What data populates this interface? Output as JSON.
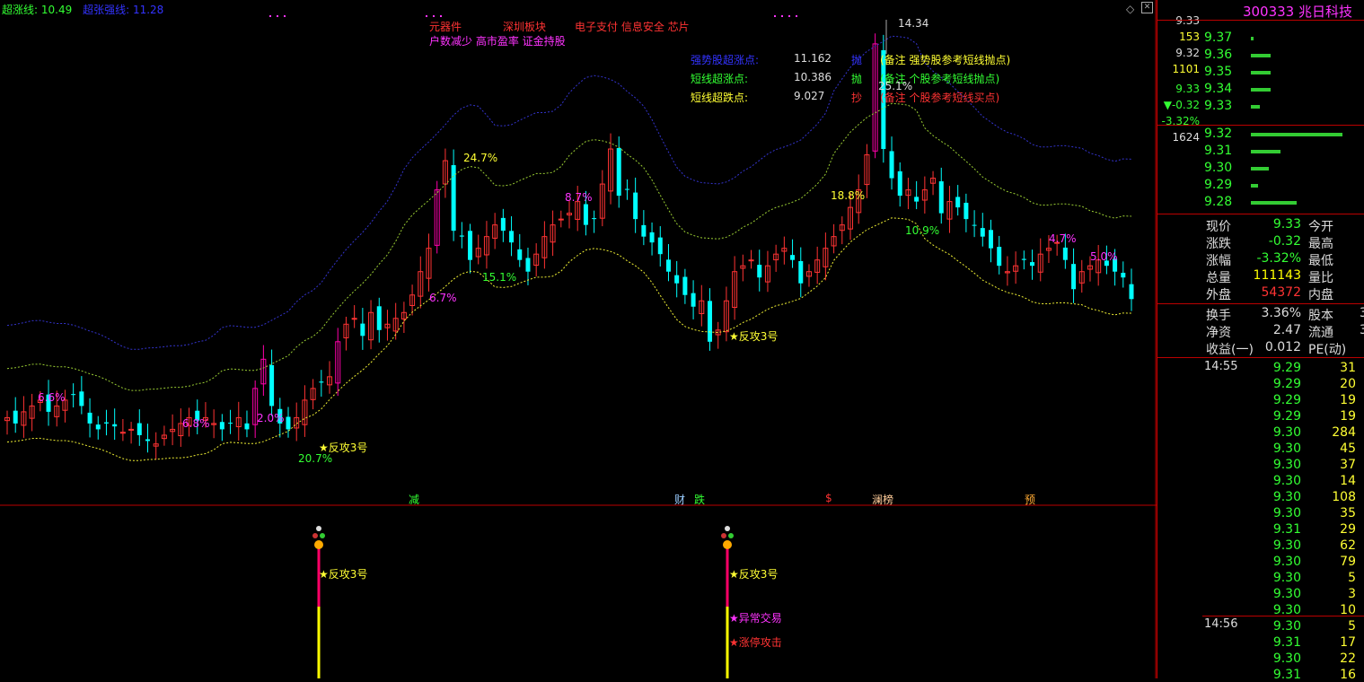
{
  "header": {
    "legend_label_1": "超涨线:",
    "legend_value_1": "10.49",
    "legend_label_2": "超张强线:",
    "legend_value_2": "11.28"
  },
  "concepts": {
    "line1": [
      "元器件",
      "深圳板块",
      "电子支付 信息安全 芯片"
    ],
    "line2": "户数减少 高市盈率 证金持股"
  },
  "info_box": {
    "rows": [
      {
        "label": "强势股超涨点:",
        "value": "11.162",
        "action": "抛",
        "note": "(备注 强势股参考短线抛点)",
        "color": "#33f"
      },
      {
        "label": "短线超涨点:",
        "value": "10.386",
        "action": "抛",
        "note": "(备注 个股参考短线抛点)",
        "color": "#3f3"
      },
      {
        "label": "短线超跌点:",
        "value": "9.027",
        "action": "抄",
        "note": "(备注 个股参考短线买点)",
        "color": "#ff3"
      }
    ]
  },
  "chart_labels": {
    "high_label": "14.34",
    "percentages": [
      "6.6%",
      "6.8%",
      "2.0%",
      "20.7%",
      "6.7%",
      "24.7%",
      "15.1%",
      "8.7%",
      "18.8%",
      "25.1%",
      "10.9%",
      "4.7%",
      "5.0%"
    ],
    "signal_main": "★反攻3号",
    "signal_main_2": "★反攻3号",
    "bottom_markers": [
      "减",
      "财",
      "跌",
      "$",
      "澜榜",
      "预"
    ],
    "sub_signal_1": "★反攻3号",
    "sub_signal_2": "★反攻3号",
    "sub_signal_3": "★异常交易",
    "sub_signal_4": "★涨停攻击"
  },
  "chart_data": {
    "type": "candlestick",
    "y_axis_main": [
      "12.00",
      "11.50",
      "11.00",
      "10.50",
      "10.00",
      "9.50",
      "9.00",
      "8.50",
      "8.00",
      "7.50",
      "7.00",
      "6.50"
    ],
    "y_axis_sub": [
      "10.00",
      "8.00",
      "6.00",
      "4.00",
      "2.00"
    ],
    "ylim_main": [
      6.2,
      12.3
    ],
    "closes": [
      7.3,
      7.2,
      7.4,
      7.5,
      7.6,
      7.4,
      7.5,
      7.6,
      7.7,
      7.5,
      7.2,
      7.1,
      7.2,
      7.15,
      7.05,
      7.1,
      7.0,
      6.9,
      6.85,
      7.0,
      7.1,
      7.2,
      7.3,
      7.25,
      7.3,
      7.2,
      7.1,
      7.2,
      7.3,
      7.1,
      7.8,
      8.3,
      7.5,
      7.2,
      7.1,
      7.3,
      7.6,
      7.8,
      7.9,
      8.0,
      8.6,
      8.9,
      9.0,
      8.7,
      9.1,
      8.8,
      8.9,
      9.0,
      9.1,
      9.4,
      9.8,
      10.2,
      11.2,
      11.7,
      10.5,
      10.4,
      10.0,
      10.2,
      10.4,
      10.6,
      10.5,
      10.3,
      10.0,
      9.8,
      10.1,
      10.4,
      10.6,
      10.7,
      10.8,
      11.0,
      10.6,
      10.7,
      11.3,
      11.9,
      11.1,
      11.2,
      10.7,
      10.4,
      10.3,
      10.1,
      9.8,
      9.6,
      9.4,
      9.2,
      9.3,
      8.6,
      8.8,
      9.3,
      9.8,
      9.9,
      10.0,
      9.7,
      9.9,
      10.1,
      10.2,
      10.0,
      9.6,
      9.8,
      10.0,
      10.2,
      10.4,
      10.6,
      10.9,
      11.2,
      11.8,
      13.7,
      11.9,
      11.4,
      11.1,
      11.2,
      11.0,
      11.2,
      11.4,
      10.8,
      11.0,
      10.9,
      10.7,
      10.6,
      10.4,
      10.2,
      9.9,
      9.8,
      9.9,
      10.0,
      9.9,
      10.1,
      10.2,
      10.3,
      10.0,
      9.5,
      9.8,
      9.9,
      10.0,
      9.9,
      9.8,
      9.7,
      9.33
    ]
  },
  "quote_panel": {
    "code": "300333",
    "name": "兆日科技",
    "left_col": [
      {
        "top": "9.33",
        "top2": "153"
      },
      {
        "top": "9.32",
        "top2": "1101"
      },
      {
        "top": "9.33",
        "top2": "▼-0.32"
      },
      {
        "top": "-3.32%",
        "top2": "1624"
      }
    ],
    "sell_levels": [
      {
        "price": "9.37",
        "bar": 0.03
      },
      {
        "price": "9.36",
        "bar": 0.22
      },
      {
        "price": "9.35",
        "bar": 0.22
      },
      {
        "price": "9.34",
        "bar": 0.22
      },
      {
        "price": "9.33",
        "bar": 0.1
      }
    ],
    "buy_levels": [
      {
        "price": "9.32",
        "bar": 1.0
      },
      {
        "price": "9.31",
        "bar": 0.32
      },
      {
        "price": "9.30",
        "bar": 0.2
      },
      {
        "price": "9.29",
        "bar": 0.08
      },
      {
        "price": "9.28",
        "bar": 0.5
      }
    ],
    "stats": [
      {
        "l1": "现价",
        "v1": "9.33",
        "l2": "今开",
        "c1": "#3f3"
      },
      {
        "l1": "涨跌",
        "v1": "-0.32",
        "l2": "最高",
        "c1": "#3f3"
      },
      {
        "l1": "涨幅",
        "v1": "-3.32%",
        "l2": "最低",
        "c1": "#3f3"
      },
      {
        "l1": "总量",
        "v1": "111143",
        "l2": "量比",
        "c1": "#ff0"
      },
      {
        "l1": "外盘",
        "v1": "54372",
        "l2": "内盘",
        "c1": "#f33"
      }
    ],
    "stats2": [
      {
        "l1": "换手",
        "v1": "3.36%",
        "l2": "股本",
        "v2": "3"
      },
      {
        "l1": "净资",
        "v1": "2.47",
        "l2": "流通",
        "v2": "3"
      },
      {
        "l1": "收益(一)",
        "v1": "0.012",
        "l2": "PE(动)",
        "v2": ""
      }
    ],
    "ticks_time_1": "14:55",
    "ticks_time_2": "14:56",
    "ticks": [
      {
        "p": "9.29",
        "v": "31"
      },
      {
        "p": "9.29",
        "v": "20"
      },
      {
        "p": "9.29",
        "v": "19"
      },
      {
        "p": "9.29",
        "v": "19"
      },
      {
        "p": "9.30",
        "v": "284"
      },
      {
        "p": "9.30",
        "v": "45"
      },
      {
        "p": "9.30",
        "v": "37"
      },
      {
        "p": "9.30",
        "v": "14"
      },
      {
        "p": "9.30",
        "v": "108"
      },
      {
        "p": "9.30",
        "v": "35"
      },
      {
        "p": "9.31",
        "v": "29"
      },
      {
        "p": "9.30",
        "v": "62"
      },
      {
        "p": "9.30",
        "v": "79"
      },
      {
        "p": "9.30",
        "v": "5"
      },
      {
        "p": "9.30",
        "v": "3"
      },
      {
        "p": "9.30",
        "v": "10"
      },
      {
        "p": "9.30",
        "v": "5"
      },
      {
        "p": "9.31",
        "v": "17"
      },
      {
        "p": "9.30",
        "v": "22"
      },
      {
        "p": "9.31",
        "v": "16"
      }
    ]
  }
}
